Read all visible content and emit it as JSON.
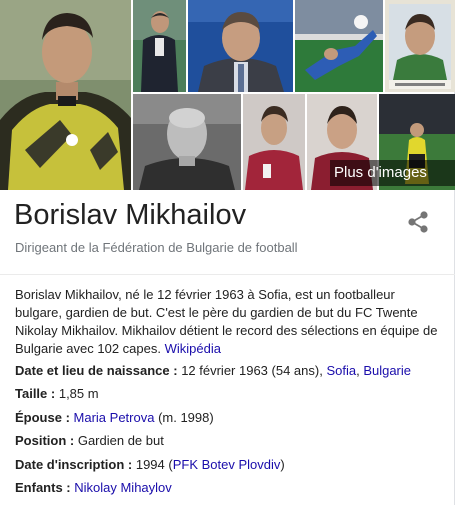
{
  "images": {
    "more_label": "Plus d'images"
  },
  "entity": {
    "name": "Borislav Mikhailov",
    "subtitle": "Dirigeant de la Fédération de Bulgarie de football"
  },
  "description": {
    "text": "Borislav Mikhailov, né le 12 février 1963 à Sofia, est un footballeur bulgare, gardien de but. C'est le père du gardien de but du FC Twente Nikolay Mikhailov. Mikhailov détient le record des sélections en équipe de Bulgarie avec 102 capes. ",
    "source": "Wikipédia"
  },
  "facts": {
    "birth": {
      "label": "Date et lieu de naissance",
      "sep": " : ",
      "value": "12 février 1963 (54 ans), ",
      "link1": "Sofia",
      "comma": ", ",
      "link2": "Bulgarie"
    },
    "height": {
      "label": "Taille",
      "sep": " : ",
      "value": "1,85 m"
    },
    "spouse": {
      "label": "Épouse",
      "sep": " : ",
      "link": "Maria Petrova",
      "suffix": " (m. 1998)"
    },
    "position": {
      "label": "Position",
      "sep": " : ",
      "value": "Gardien de but"
    },
    "signing": {
      "label": "Date d'inscription",
      "sep": " : ",
      "value": "1994 (",
      "link": "PFK Botev Plovdiv",
      "suffix": ")"
    },
    "children": {
      "label": "Enfants",
      "sep": " : ",
      "link": "Nikolay Mihaylov"
    }
  },
  "colors": {
    "link": "#1a0dab",
    "subtitle": "#70757a",
    "text": "#222222"
  }
}
